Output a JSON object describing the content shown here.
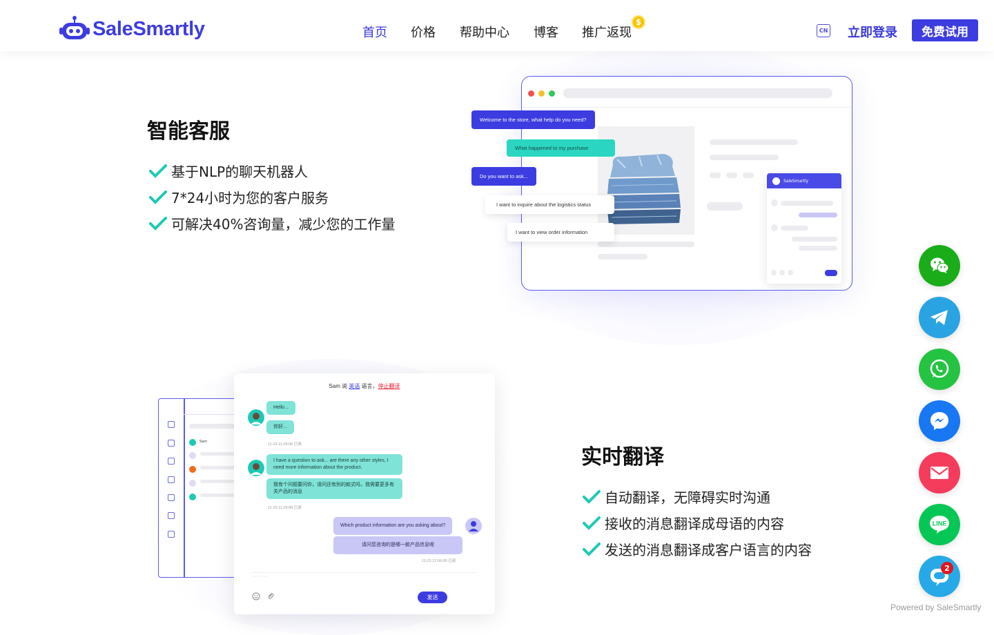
{
  "brand": {
    "name": "SaleSmartly",
    "color": "#3c3ce0"
  },
  "nav": {
    "items": [
      "首页",
      "价格",
      "帮助中心",
      "博客",
      "推广返现"
    ],
    "active_index": 0,
    "coin_symbol": "$"
  },
  "header": {
    "lang_icon": "CN",
    "login_label": "立即登录",
    "trial_label": "免费试用"
  },
  "section1": {
    "title": "智能客服",
    "features": [
      "基于NLP的聊天机器人",
      "7*24小时为您的客户服务",
      "可解决40%咨询量，减少您的工作量"
    ],
    "bubbles": [
      "Welcome to the store, what help do you need?",
      "What happened to my purchase",
      "Do you want to ask...",
      "I want to inquire about the logistics status",
      "I want to view order information"
    ],
    "widget_title": "SaleSmartly"
  },
  "section2": {
    "title": "实时翻译",
    "features": [
      "自动翻译，无障碍实时沟通",
      "接收的消息翻译成母语的内容",
      "发送的消息翻译成客户语言的内容"
    ],
    "chat": {
      "header_prefix": "Sam 说 ",
      "header_lang": "英语",
      "header_mid": " 语言，",
      "header_stop": "停止翻译",
      "sidebar_contact": "Sam",
      "msg1": "Hello...",
      "msg1_tr": "你好...",
      "ts1": "11-23  11:29:06  已读",
      "msg2": "I have a question to ask... are there any other styles, I need more information about the product.",
      "msg2_tr": "我有个问题要问你，请问还有别的款式吗，我需要更多有关产品的消息",
      "ts2": "11-23  11:29:08  已读",
      "msg3": "Which product information are you asking about?",
      "msg3_tr": "请问您咨询的是哪一款产品信息呢",
      "ts3": "11-23  12:06:09  已读",
      "input_placeholder": "·······",
      "send_label": "发送"
    }
  },
  "socials": [
    {
      "name": "wechat",
      "color": "#1aad19"
    },
    {
      "name": "telegram",
      "color": "#2aa3e3"
    },
    {
      "name": "whatsapp",
      "color": "#25c342"
    },
    {
      "name": "messenger",
      "color": "#1877f2"
    },
    {
      "name": "email",
      "color": "#f53c5c"
    },
    {
      "name": "line",
      "color": "#06c755"
    },
    {
      "name": "chat",
      "color": "#27a9e8",
      "badge": "2"
    }
  ],
  "powered_by": "Powered by SaleSmartly"
}
